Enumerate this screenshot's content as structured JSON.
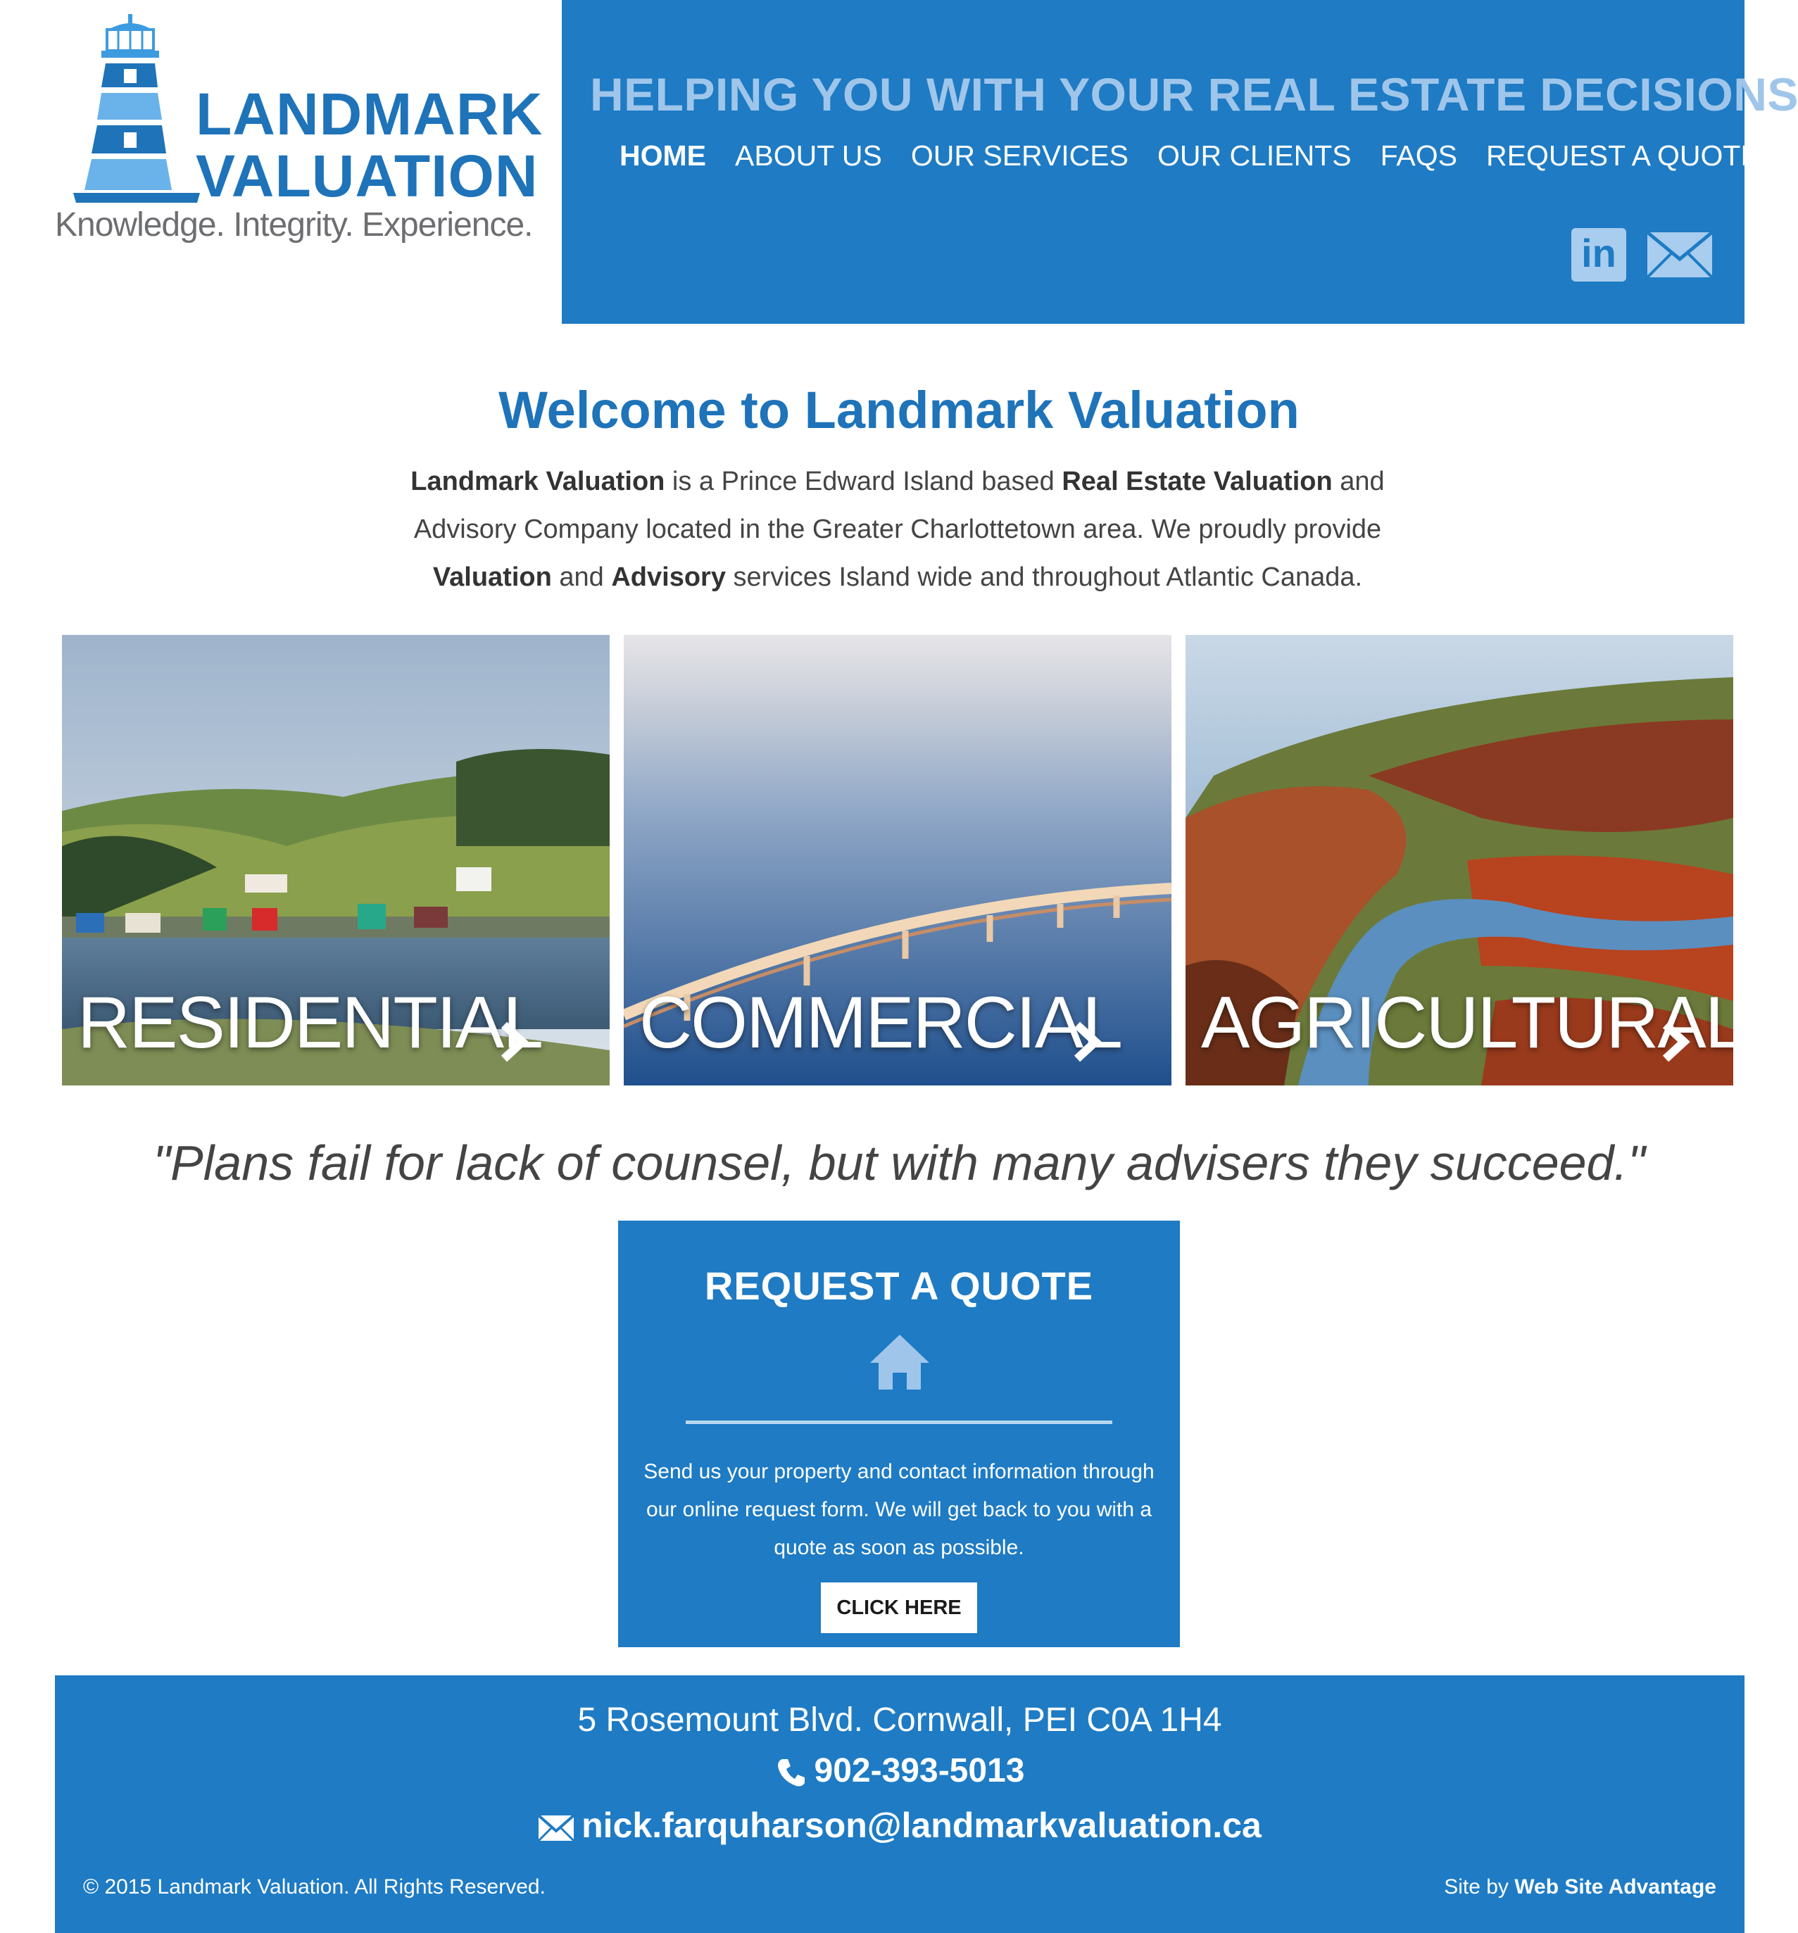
{
  "brand": {
    "line1": "LANDMARK",
    "line2": "VALUATION",
    "tagline": "Knowledge. Integrity. Experience.",
    "color": "#1e73b9"
  },
  "header": {
    "slogan": "HELPING YOU WITH YOUR REAL ESTATE DECISIONS",
    "nav": [
      "HOME",
      "ABOUT US",
      "OUR SERVICES",
      "OUR CLIENTS",
      "FAQS",
      "REQUEST A QUOTE"
    ],
    "active_nav": "HOME",
    "social": {
      "linkedin_icon": "linkedin-icon",
      "linkedin_text": "in",
      "email_icon": "envelope-icon"
    },
    "panel_color": "#1e7bc4"
  },
  "welcome": {
    "title": "Welcome to Landmark Valuation",
    "p1_b1": "Landmark Valuation",
    "p1_t1": " is a Prince Edward Island based ",
    "p1_b2": "Real Estate Valuation",
    "p1_t2": " and Advisory Company located in the Greater Charlottetown area. We proudly provide ",
    "p1_b3": "Valuation",
    "p1_t3": " and ",
    "p1_b4": "Advisory",
    "p1_t4": " services Island wide and throughout Atlantic Canada."
  },
  "services": [
    {
      "label": "RESIDENTIAL",
      "icon": "chevron-right-icon"
    },
    {
      "label": "COMMERCIAL",
      "icon": "chevron-right-icon"
    },
    {
      "label": "AGRICULTURAL",
      "icon": "chevron-right-icon"
    }
  ],
  "quote": "\"Plans fail for lack of counsel, but with many advisers they succeed.\"",
  "request_quote": {
    "title": "REQUEST A QUOTE",
    "icon": "home-icon",
    "text": "Send us your property and contact information through our online request form. We will get back to you with a quote as soon as possible.",
    "button": "CLICK HERE"
  },
  "footer": {
    "address": "5 Rosemount Blvd. Cornwall, PEI C0A 1H4",
    "phone": "902-393-5013",
    "email": "nick.farquharson@landmarkvaluation.ca",
    "copyright": "© 2015 Landmark Valuation. All Rights Reserved.",
    "credit_prefix": "Site by ",
    "credit_name": "Web Site Advantage"
  }
}
